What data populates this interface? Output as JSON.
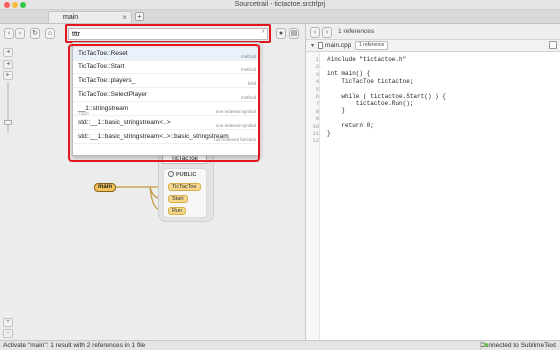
{
  "window": {
    "title": "Sourcetrail - tictactoe.srctrlprj"
  },
  "tabs": [
    {
      "label": "main",
      "close": "×"
    }
  ],
  "tab_add": "+",
  "toolbar": {
    "back": "‹",
    "forward": "›",
    "refresh": "↻",
    "home": "⌂",
    "search_value": "tttr",
    "search_chevron": "›",
    "left_btns": [
      "‹",
      "›"
    ]
  },
  "autocomplete": [
    {
      "pre": "",
      "hl": "T",
      "name": "icTacToe::Reset",
      "full": "TicTacToe::Reset",
      "type": "method"
    },
    {
      "pre": "",
      "hl": "",
      "name": "TicTacToe::Start",
      "full": "TicTacToe::Start",
      "type": "method"
    },
    {
      "pre": "",
      "hl": "",
      "name": "TicTacToe::players_",
      "full": "TicTacToe::players_",
      "type": "field"
    },
    {
      "pre": "",
      "hl": "",
      "name": "TicTacToe::SelectPlayer",
      "full": "TicTacToe::SelectPlayer",
      "type": "method"
    },
    {
      "full": "__1::stringstream",
      "sub": "<std>",
      "type": "non-indexed symbol"
    },
    {
      "full": "std::__1::basic_stringstream<..>",
      "type": "non-indexed symbol"
    },
    {
      "full": "std::__1::basic_stringstream<..>::basic_stringstream",
      "type": "non-indexed function"
    }
  ],
  "graph": {
    "card_title": "TicTacToe",
    "public_label": "PUBLIC",
    "main_node": "main",
    "members": [
      "TicTacToe",
      "Start",
      "Run"
    ]
  },
  "code_panel": {
    "references": "1 references",
    "file_name": "main.cpp",
    "file_badge": "1 reference",
    "lines": [
      {
        "n": "1",
        "text": "#include \"tictactoe.h\""
      },
      {
        "n": "2",
        "text": ""
      },
      {
        "n": "3",
        "text": "int main() {"
      },
      {
        "n": "4",
        "text": "    TicTacToe tictactoe;"
      },
      {
        "n": "5",
        "text": ""
      },
      {
        "n": "6",
        "text": "    while ( tictactoe.Start() ) {"
      },
      {
        "n": "7",
        "text": "        tictactoe.Run();"
      },
      {
        "n": "8",
        "text": "    }"
      },
      {
        "n": "9",
        "text": ""
      },
      {
        "n": "10",
        "text": "    return 0;"
      },
      {
        "n": "11",
        "text": "}"
      },
      {
        "n": "12",
        "text": ""
      }
    ]
  },
  "status": {
    "left": "Activate \"main\": 1 result with 2 references in 1 file",
    "right": "Connected to SublimeText"
  },
  "colors": {
    "annotation_red": "#e0161c",
    "node_fill": "#f5d78e",
    "highlight": "#f7c85f"
  }
}
